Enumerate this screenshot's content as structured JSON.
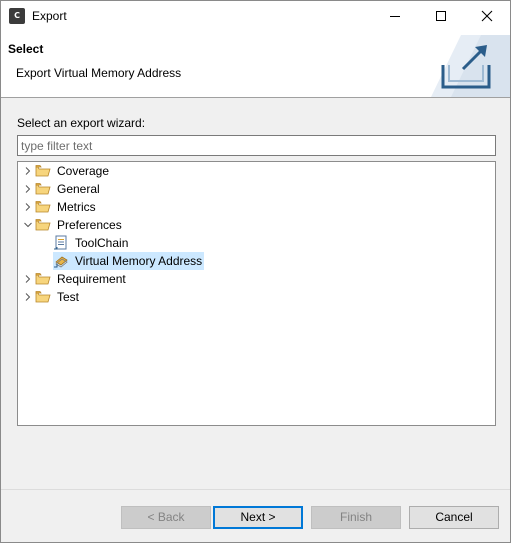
{
  "window": {
    "title": "Export",
    "app_icon_text": "C"
  },
  "header": {
    "title": "Select",
    "subtitle": "Export Virtual Memory Address"
  },
  "wizard": {
    "label": "Select an export wizard:",
    "filter_placeholder": "type filter text",
    "filter_value": ""
  },
  "tree": {
    "items": [
      {
        "label": "Coverage",
        "icon": "folder-icon",
        "expanded": false,
        "level": 0
      },
      {
        "label": "General",
        "icon": "folder-icon",
        "expanded": false,
        "level": 0
      },
      {
        "label": "Metrics",
        "icon": "folder-icon",
        "expanded": false,
        "level": 0
      },
      {
        "label": "Preferences",
        "icon": "folder-open-icon",
        "expanded": true,
        "level": 0
      },
      {
        "label": "ToolChain",
        "icon": "document-export-icon",
        "level": 1
      },
      {
        "label": "Virtual Memory Address",
        "icon": "memory-export-icon",
        "level": 1,
        "selected": true
      },
      {
        "label": "Requirement",
        "icon": "folder-icon",
        "expanded": false,
        "level": 0
      },
      {
        "label": "Test",
        "icon": "folder-icon",
        "expanded": false,
        "level": 0
      }
    ]
  },
  "buttons": {
    "back": "< Back",
    "next": "Next >",
    "finish": "Finish",
    "cancel": "Cancel"
  },
  "colors": {
    "selection": "#cce8ff",
    "accent": "#0078d7",
    "folder": "#e8b64a"
  }
}
